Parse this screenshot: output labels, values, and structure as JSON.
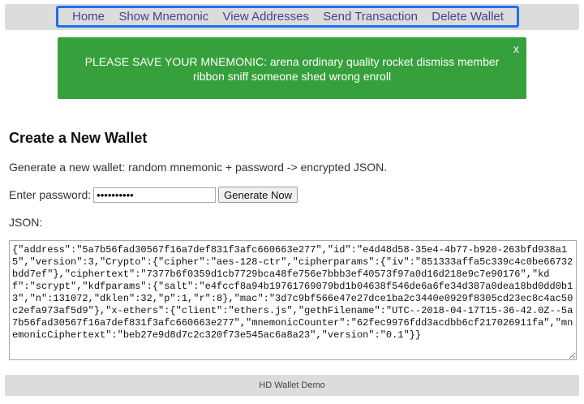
{
  "nav": {
    "items": [
      {
        "label": "Home"
      },
      {
        "label": "Show Mnemonic"
      },
      {
        "label": "View Addresses"
      },
      {
        "label": "Send Transaction"
      },
      {
        "label": "Delete Wallet"
      }
    ]
  },
  "alert": {
    "message": "PLEASE SAVE YOUR MNEMONIC: arena ordinary quality rocket dismiss member ribbon sniff someone shed wrong enroll",
    "close": "x",
    "color": "#36a13c"
  },
  "main": {
    "title": "Create a New Wallet",
    "description": "Generate a new wallet: random mnemonic + password -> encrypted JSON.",
    "password_label": "Enter password:",
    "password_value": "••••••••••",
    "generate_button": "Generate Now",
    "json_label": "JSON:",
    "json_value": "{\"address\":\"5a7b56fad30567f16a7def831f3afc660663e277\",\"id\":\"e4d48d58-35e4-4b77-b920-263bfd938a15\",\"version\":3,\"Crypto\":{\"cipher\":\"aes-128-ctr\",\"cipherparams\":{\"iv\":\"851333affa5c339c4c0be66732bdd7ef\"},\"ciphertext\":\"7377b6f0359d1cb7729bca48fe756e7bbb3ef40573f97a0d16d218e9c7e90176\",\"kdf\":\"scrypt\",\"kdfparams\":{\"salt\":\"e4fccf8a94b19761769079bd1b04638f546de6a6fe34d387a0dea18bd0dd0b13\",\"n\":131072,\"dklen\":32,\"p\":1,\"r\":8},\"mac\":\"3d7c9bf566e47e27dce1ba2c3440e0929f8305cd23ec8c4ac50c2efa973af5d9\"},\"x-ethers\":{\"client\":\"ethers.js\",\"gethFilename\":\"UTC--2018-04-17T15-36-42.0Z--5a7b56fad30567f16a7def831f3afc660663e277\",\"mnemonicCounter\":\"62fec9976fdd3acdbb6cf217026911fa\",\"mnemonicCiphertext\":\"beb27e9d8d7c2c320f73e545ac6a8a23\",\"version\":\"0.1\"}}"
  },
  "footer": {
    "text": "HD Wallet Demo"
  },
  "colors": {
    "nav_focus_border": "#1e6ff0",
    "nav_link": "#4b3f8a"
  }
}
